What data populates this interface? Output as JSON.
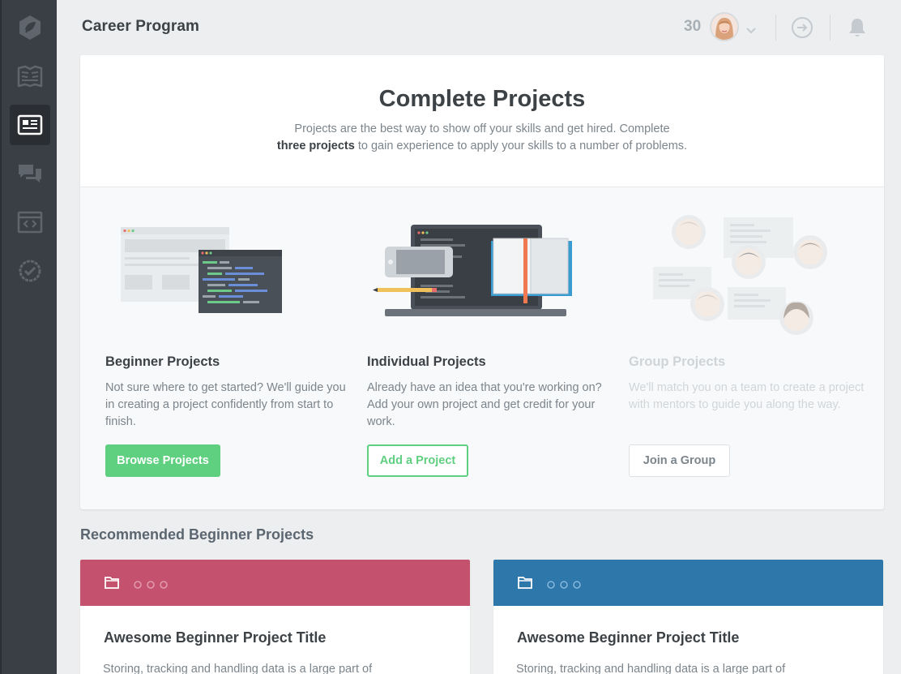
{
  "header": {
    "title": "Career Program",
    "points": "30"
  },
  "sidebar": {
    "items": [
      {
        "icon": "treehouse-logo-icon"
      },
      {
        "icon": "library-map-icon"
      },
      {
        "icon": "projects-icon",
        "active": true
      },
      {
        "icon": "community-chat-icon"
      },
      {
        "icon": "workspaces-code-icon"
      },
      {
        "icon": "badge-check-icon"
      }
    ]
  },
  "hero": {
    "title": "Complete Projects",
    "desc_line1": "Projects are the best way to show off your skills and get hired. Complete",
    "desc_bold": "three projects",
    "desc_line2": " to gain experience to apply your skills to a number of problems."
  },
  "columns": [
    {
      "title": "Beginner Projects",
      "desc": "Not sure where to get started? We'll guide you in creating a project confidently from start to finish.",
      "button": "Browse Projects"
    },
    {
      "title": "Individual Projects",
      "desc": "Already have an idea that you're working on? Add your own project and get credit for your work.",
      "button": "Add a Project"
    },
    {
      "title": "Group Projects",
      "desc": "We'll match you on a team to create a project with mentors to guide you along the way.",
      "button": "Join a Group"
    }
  ],
  "recommended": {
    "title": "Recommended Beginner Projects",
    "cards": [
      {
        "title": "Awesome Beginner Project Title",
        "desc": "Storing, tracking and handling data is a large part of",
        "color": "#c4526f"
      },
      {
        "title": "Awesome Beginner Project Title",
        "desc": "Storing, tracking and handling data is a large part of",
        "color": "#2e77ab"
      }
    ]
  },
  "colors": {
    "accent_green": "#5fcf80",
    "sidebar_bg": "#3a3f45"
  }
}
